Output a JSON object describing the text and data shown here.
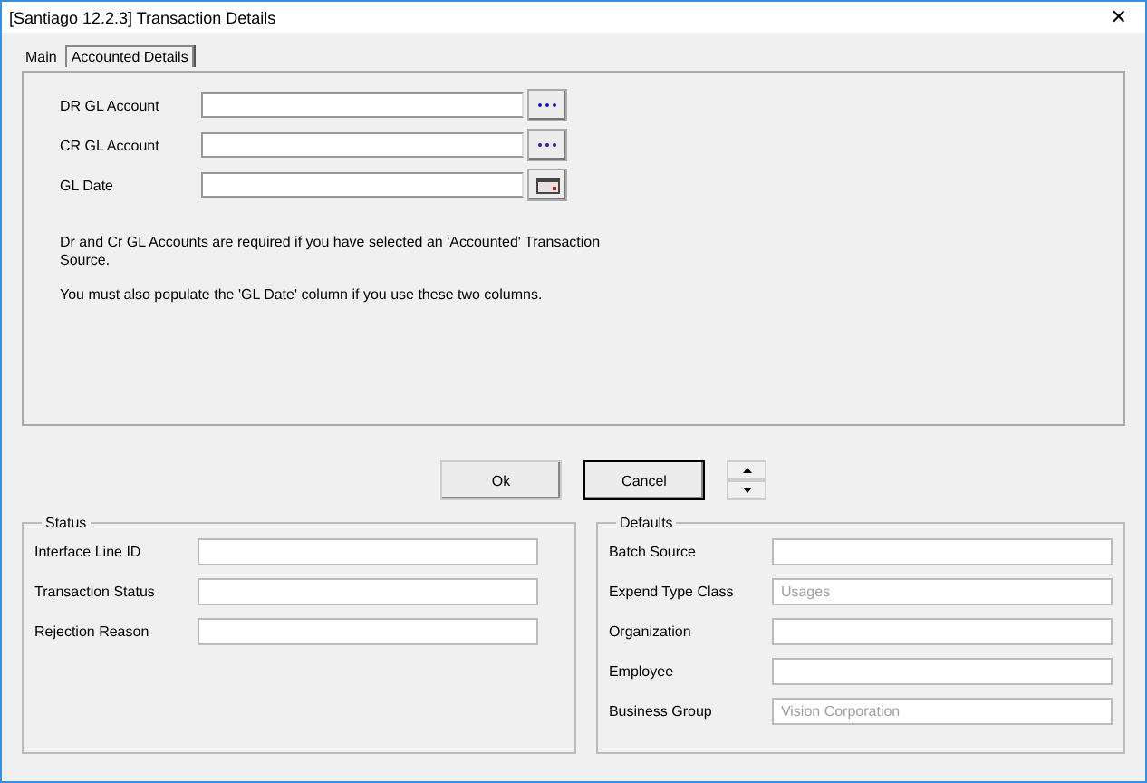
{
  "window": {
    "title": "[Santiago 12.2.3] Transaction Details",
    "close": "✕"
  },
  "tabs": [
    {
      "label": "Main",
      "selected": false
    },
    {
      "label": "Accounted Details",
      "selected": true
    }
  ],
  "accounted_fields": [
    {
      "label": "DR GL Account",
      "kind": "lookup"
    },
    {
      "label": "CR GL Account",
      "kind": "lookup"
    },
    {
      "label": "GL Date",
      "kind": "calendar"
    }
  ],
  "notes": [
    "Dr and Cr GL Accounts are required if you have selected an 'Accounted' Transaction Source.",
    "You must also populate the 'GL Date' column if you use these two columns."
  ],
  "buttons": [
    {
      "label": "Ok",
      "default": false
    },
    {
      "label": "Cancel",
      "default": true
    }
  ],
  "status": {
    "title": "Status",
    "fields": [
      {
        "label": "Interface Line ID"
      },
      {
        "label": "Transaction Status"
      },
      {
        "label": "Rejection Reason"
      }
    ]
  },
  "defaults": {
    "title": "Defaults",
    "fields": [
      {
        "label": "Batch Source"
      },
      {
        "label": "Expend Type Class",
        "value": "Usages",
        "disabled": true
      },
      {
        "label": "Organization"
      },
      {
        "label": "Employee"
      },
      {
        "label": "Business Group",
        "value": "Vision Corporation",
        "disabled": true
      }
    ]
  }
}
